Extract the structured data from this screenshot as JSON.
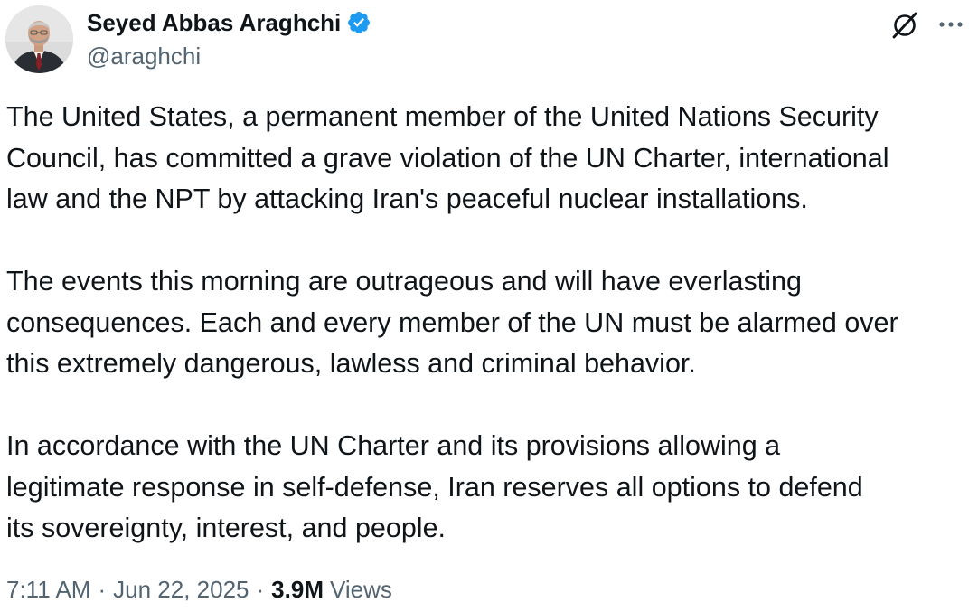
{
  "author": {
    "display_name": "Seyed Abbas Araghchi",
    "handle": "@araghchi",
    "verified": true,
    "verified_color": "#1d9bf0",
    "avatar_icon": "profile-photo"
  },
  "header_actions": {
    "grok_icon": "grok-icon",
    "more_icon": "more-icon"
  },
  "tweet": {
    "paragraphs": [
      "The United States, a permanent member of the United Nations Security\nCouncil, has committed a grave violation of the UN Charter, international\nlaw and the NPT by attacking Iran's peaceful nuclear installations.",
      "The events this morning are outrageous and will have everlasting\nconsequences. Each and every member of the UN must be alarmed over\nthis extremely dangerous, lawless and criminal behavior.",
      "In accordance with the UN Charter and its provisions allowing a\nlegitimate response in self-defense, Iran reserves all options to defend\nits sovereignty, interest, and people."
    ]
  },
  "meta": {
    "time": "7:11 AM",
    "separator": "·",
    "date": "Jun 22, 2025",
    "views_count": "3.9M",
    "views_label": "Views"
  },
  "colors": {
    "text_primary": "#0f1419",
    "text_secondary": "#536471",
    "background": "#ffffff"
  }
}
